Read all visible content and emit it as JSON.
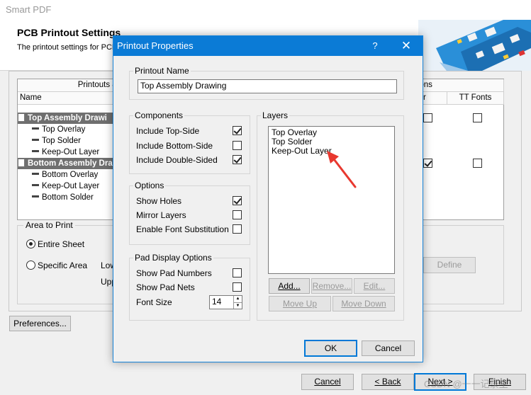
{
  "wizard": {
    "title": "Smart PDF",
    "heading": "PCB Printout Settings",
    "subheading": "The printout settings for PCB",
    "columns": {
      "printouts": "Printouts &",
      "options": "out Options",
      "name": "Name",
      "layer_col": "r",
      "tt_fonts": "TT Fonts"
    },
    "tree": [
      {
        "label": "Top Assembly Drawi",
        "kind": "printout",
        "selected": true
      },
      {
        "label": "Top Overlay",
        "kind": "layer"
      },
      {
        "label": "Top Solder",
        "kind": "layer"
      },
      {
        "label": "Keep-Out Layer",
        "kind": "layer"
      },
      {
        "label": "Bottom Assembly Dra",
        "kind": "printout",
        "selected": true
      },
      {
        "label": "Bottom Overlay",
        "kind": "layer"
      },
      {
        "label": "Keep-Out Layer",
        "kind": "layer"
      },
      {
        "label": "Bottom Solder",
        "kind": "layer"
      }
    ],
    "area_to_print": {
      "legend": "Area to Print",
      "entire_sheet": "Entire Sheet",
      "specific_area": "Specific Area",
      "lower_label": "Low",
      "upper_label": "Upp",
      "selected": "entire_sheet",
      "define": "Define"
    },
    "preferences": "Preferences...",
    "cancel": "Cancel",
    "back": "< Back",
    "next": "Next >",
    "finish": "Finish",
    "watermark": "CSDN @一一记录生"
  },
  "dialog": {
    "title": "Printout Properties",
    "help": "?",
    "close": "✕",
    "printout_name_label": "Printout Name",
    "printout_name_value": "Top Assembly Drawing",
    "components": {
      "legend": "Components",
      "items": [
        {
          "label": "Include Top-Side",
          "checked": true
        },
        {
          "label": "Include Bottom-Side",
          "checked": false
        },
        {
          "label": "Include Double-Sided",
          "checked": true
        }
      ]
    },
    "options": {
      "legend": "Options",
      "items": [
        {
          "label": "Show Holes",
          "checked": true
        },
        {
          "label": "Mirror Layers",
          "checked": false
        },
        {
          "label": "Enable Font Substitution",
          "checked": false
        }
      ]
    },
    "pad_display": {
      "legend": "Pad Display Options",
      "items": [
        {
          "label": "Show Pad Numbers",
          "checked": false
        },
        {
          "label": "Show Pad Nets",
          "checked": false
        }
      ],
      "font_size_label": "Font Size",
      "font_size_value": "14"
    },
    "layers": {
      "legend": "Layers",
      "items": [
        "Top Overlay",
        "Top Solder",
        "Keep-Out Layer"
      ],
      "add": "Add...",
      "remove": "Remove...",
      "edit": "Edit...",
      "move_up": "Move Up",
      "move_down": "Move Down"
    },
    "ok": "OK",
    "cancel": "Cancel"
  },
  "colors": {
    "dialog_titlebar": "#0b7bd6",
    "annotation_arrow": "#e8382f"
  }
}
